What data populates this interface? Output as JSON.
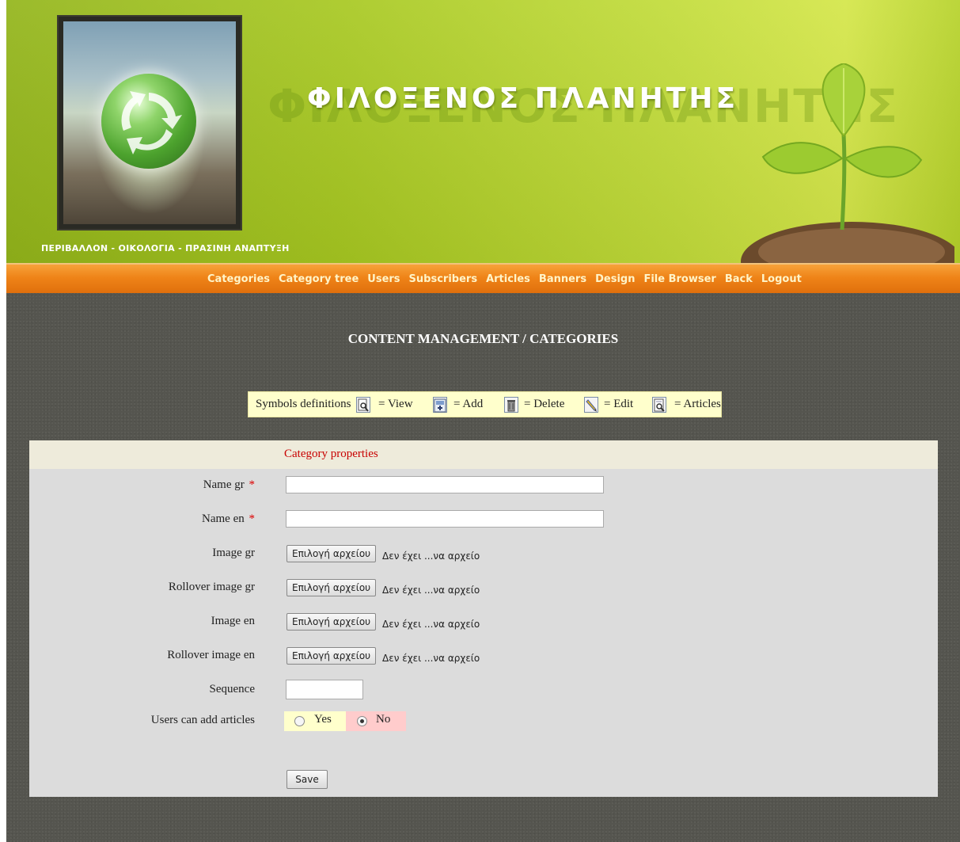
{
  "header": {
    "site_title": "ΦΙΛΟΞΕΝΟΣ  ΠΛΑΝΗΤΗΣ",
    "tagline": "ΠΕΡΙΒΑΛΛΟΝ - ΟΙΚΟΛΟΓΙΑ - ΠΡΑΣΙΝΗ ΑΝΑΠΤΥΞΗ",
    "logo_icon": "recycle-globe-icon",
    "decoration_icon": "sprout-icon"
  },
  "nav": {
    "items": [
      {
        "label": "Categories"
      },
      {
        "label": "Category tree"
      },
      {
        "label": "Users"
      },
      {
        "label": "Subscribers"
      },
      {
        "label": "Articles"
      },
      {
        "label": "Banners"
      },
      {
        "label": "Design"
      },
      {
        "label": "File Browser"
      },
      {
        "label": "Back"
      },
      {
        "label": "Logout"
      }
    ]
  },
  "page": {
    "heading": "CONTENT MANAGEMENT / CATEGORIES"
  },
  "legend": {
    "title": "Symbols definitions",
    "items": [
      {
        "icon": "view-icon",
        "label": "= View"
      },
      {
        "icon": "add-icon",
        "label": "= Add"
      },
      {
        "icon": "delete-icon",
        "label": "= Delete"
      },
      {
        "icon": "edit-icon",
        "label": "= Edit"
      },
      {
        "icon": "articles-icon",
        "label": "= Articles"
      }
    ]
  },
  "form": {
    "title": "Category properties",
    "required_marker": "*",
    "fields": {
      "name_gr": {
        "label": "Name gr",
        "value": ""
      },
      "name_en": {
        "label": "Name en",
        "value": ""
      },
      "image_gr": {
        "label": "Image gr",
        "button": "Επιλογή αρχείου",
        "status": "Δεν έχει ...να αρχείο"
      },
      "rollover_gr": {
        "label": "Rollover image gr",
        "button": "Επιλογή αρχείου",
        "status": "Δεν έχει ...να αρχείο"
      },
      "image_en": {
        "label": "Image en",
        "button": "Επιλογή αρχείου",
        "status": "Δεν έχει ...να αρχείο"
      },
      "rollover_en": {
        "label": "Rollover image en",
        "button": "Επιλογή αρχείου",
        "status": "Δεν έχει ...να αρχείο"
      },
      "sequence": {
        "label": "Sequence",
        "value": ""
      },
      "users_can_add": {
        "label": "Users can add articles",
        "options": [
          {
            "label": "Yes",
            "selected": false
          },
          {
            "label": "No",
            "selected": true
          }
        ]
      }
    },
    "save_label": "Save"
  },
  "colors": {
    "header_green": "#a7c821",
    "nav_orange": "#ef8418",
    "nav_text": "#fff4c8",
    "body_bg": "#55554f",
    "form_title_red": "#c80000",
    "legend_bg": "#ffffcc",
    "radio_yes_bg": "#ffffcc",
    "radio_no_bg": "#ffcccc"
  }
}
